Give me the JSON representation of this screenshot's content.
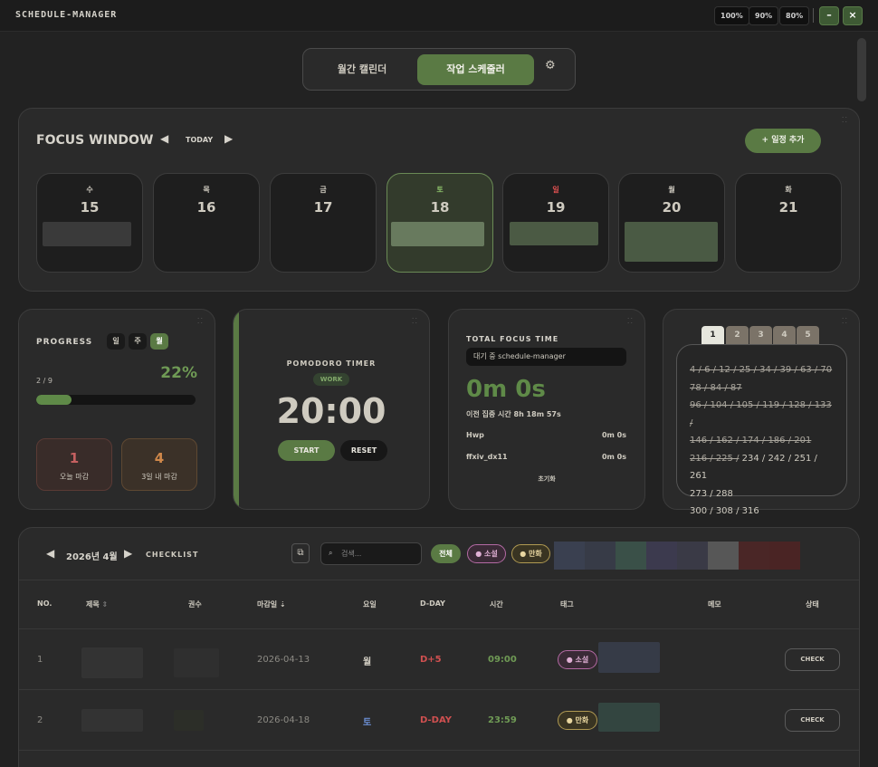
{
  "app": {
    "title": "SCHEDULE-MANAGER"
  },
  "window_controls": {
    "zoom": [
      "100%",
      "90%",
      "80%"
    ],
    "minimize": "–",
    "close": "×"
  },
  "tabs": {
    "items": [
      "월간 캘린더",
      "작업 스케줄러"
    ],
    "active": 1,
    "settings_icon": "gear-icon"
  },
  "focus_window": {
    "title": "FOCUS WINDOW",
    "prev": "◀",
    "today_label": "TODAY",
    "next": "▶",
    "add_button": "+ 일정 추가",
    "days": [
      {
        "weekday": "수",
        "date": "15"
      },
      {
        "weekday": "목",
        "date": "16"
      },
      {
        "weekday": "금",
        "date": "17"
      },
      {
        "weekday": "토",
        "date": "18"
      },
      {
        "weekday": "일",
        "date": "19"
      },
      {
        "weekday": "월",
        "date": "20"
      },
      {
        "weekday": "화",
        "date": "21"
      }
    ]
  },
  "progress": {
    "title": "PROGRESS",
    "periods": [
      "일",
      "주",
      "월"
    ],
    "active_period": 2,
    "count": "2 / 9",
    "percent": "22%",
    "percent_value": 22,
    "stats": [
      {
        "value": "1",
        "label": "오늘 마감",
        "color": "#c56060"
      },
      {
        "value": "4",
        "label": "3일 내 마감",
        "color": "#d0884a"
      }
    ]
  },
  "pomodoro": {
    "title": "POMODORO TIMER",
    "mode": "WORK",
    "time": "20:00",
    "start": "START",
    "reset": "RESET"
  },
  "total_focus": {
    "title": "TOTAL FOCUS TIME",
    "status": "대기 중 schedule-manager",
    "time": "0m 0s",
    "previous": "이전 집중 시간 8h 18m 57s",
    "apps": [
      {
        "name": "Hwp",
        "time": "0m 0s"
      },
      {
        "name": "ffxiv_dx11",
        "time": "0m 0s"
      }
    ],
    "reset": "초기화"
  },
  "numbers_panel": {
    "tabs": [
      "1",
      "2",
      "3",
      "4",
      "5"
    ],
    "active_tab": 0,
    "lines": [
      {
        "text": "4 / 6 / 12 / 25 / 34 / 39 / 63 / 70",
        "struck": true
      },
      {
        "text": "78 / 84 / 87",
        "struck": true
      },
      {
        "text": "96 / 104 / 105 / 119 / 128 / 133 /",
        "struck": true
      },
      {
        "text": "146 / 162 / 174 / 186 / 201",
        "struck": true
      },
      {
        "struck_part": "216 / 225 /",
        "rest": " 234 / 242 / 251 / 261"
      },
      {
        "text": "273 / 288",
        "struck": false
      },
      {
        "text": "300 / 308 / 316",
        "struck": false
      }
    ]
  },
  "checklist": {
    "prev": "◀",
    "month": "2026년 4월",
    "next": "▶",
    "label": "CHECKLIST",
    "search_placeholder": "검색...",
    "filters": [
      {
        "label": "전체",
        "active": true
      },
      {
        "label": "● 소설",
        "color": "#d47fc0"
      },
      {
        "label": "● 만화",
        "color": "#e0c060"
      }
    ],
    "swatches": [
      "#3a4050",
      "#373b47",
      "#3a5048",
      "#3c3a4e",
      "#3a3a46",
      "#575757",
      "#4a2626",
      "#4a2424"
    ],
    "columns": [
      "NO.",
      "제목",
      "권수",
      "마감일",
      "요일",
      "D-DAY",
      "시간",
      "태그",
      "메모",
      "상태"
    ],
    "rows": [
      {
        "no": "1",
        "due": "2026-04-13",
        "weekday": "월",
        "dday": "D+5",
        "time": "09:00",
        "tag": "● 소설",
        "action": "CHECK"
      },
      {
        "no": "2",
        "due": "2026-04-18",
        "weekday": "토",
        "dday": "D-DAY",
        "time": "23:59",
        "tag": "● 만화",
        "action": "CHECK"
      }
    ]
  }
}
